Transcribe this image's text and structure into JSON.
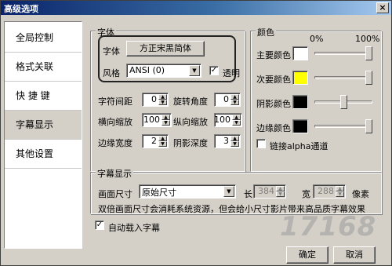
{
  "window": {
    "title": "高级选项",
    "close_glyph": "×"
  },
  "sidebar": {
    "items": [
      {
        "label": "全局控制"
      },
      {
        "label": "格式关联"
      },
      {
        "label": "快 捷 键"
      },
      {
        "label": "字幕显示",
        "active": true
      },
      {
        "label": "其他设置"
      }
    ]
  },
  "font_group": {
    "title": "字体",
    "font_label": "字体",
    "font_button": "方正宋黑简体",
    "style_label": "风格",
    "style_value": "ANSI (0)",
    "transparent_label": "透明",
    "transparent_checked": true,
    "char_spacing_label": "字符间距",
    "char_spacing": "0",
    "rotation_label": "旋转角度",
    "rotation": "0",
    "h_scale_label": "横向缩放",
    "h_scale": "100",
    "v_scale_label": "纵向缩放",
    "v_scale": "100",
    "border_width_label": "边缘宽度",
    "border_width": "2",
    "shadow_depth_label": "阴影深度",
    "shadow_depth": "3"
  },
  "color_group": {
    "title": "颜色",
    "scale_min": "0%",
    "scale_max": "100%",
    "rows": [
      {
        "label": "主要颜色",
        "color": "#ffffff",
        "level": 1.0
      },
      {
        "label": "次要颜色",
        "color": "#ffff00",
        "level": 1.0
      },
      {
        "label": "阴影颜色",
        "color": "#000000",
        "level": 0.5
      },
      {
        "label": "边缘颜色",
        "color": "#000000",
        "level": 1.0
      }
    ],
    "alpha_link_label": "链接alpha通道",
    "alpha_link_checked": false
  },
  "subtitle_group": {
    "title": "字幕显示",
    "size_label": "画面尺寸",
    "size_value": "原始尺寸",
    "length_label": "长",
    "length_value": "384",
    "width_label": "宽",
    "width_value": "288",
    "unit_label": "像素",
    "note": "双倍画面尺寸会消耗系统资源，但会给小尺寸影片带来高品质字幕效果"
  },
  "auto_load": {
    "label": "自动载入字幕",
    "checked": true
  },
  "footer": {
    "ok_label": "确定",
    "cancel_label": "取消"
  },
  "watermark": {
    "text": "17168"
  }
}
